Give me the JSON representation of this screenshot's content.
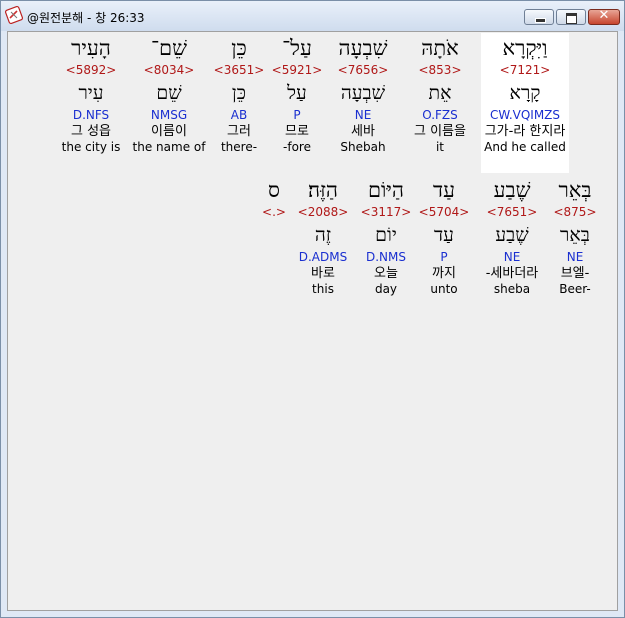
{
  "window": {
    "title": "@원전분해 - 창 26:33",
    "close_glyph": "✕"
  },
  "rows": [
    {
      "words": [
        {
          "heb": "וַיִּקְרָא",
          "num": "<7121>",
          "lex": "קָרָא",
          "morph": "CW.VQIMZS",
          "kor": "그가-라 한지라",
          "eng": "And he called",
          "highlight": true
        },
        {
          "heb": "אֹתָהּ",
          "num": "<853>",
          "lex": "אֵת",
          "morph": "O.FZS",
          "kor": "그 이름을",
          "eng": "it"
        },
        {
          "heb": "שִׁבְעָה",
          "num": "<7656>",
          "lex": "שִׁבְעָה",
          "morph": "NE",
          "kor": "세바",
          "eng": "Shebah"
        },
        {
          "heb": "עַל־",
          "num": "<5921>",
          "lex": "עַל",
          "morph": "P",
          "kor": "므로",
          "eng": "-fore"
        },
        {
          "heb": "כֵּן",
          "num": "<3651>",
          "lex": "כֵּן",
          "morph": "AB",
          "kor": "그러",
          "eng": "there-"
        },
        {
          "heb": "שֵׁם־",
          "num": "<8034>",
          "lex": "שֵׁם",
          "morph": "NMSG",
          "kor": "이름이",
          "eng": "the name of"
        },
        {
          "heb": "הָעִיר",
          "num": "<5892>",
          "lex": "עִיר",
          "morph": "D.NFS",
          "kor": "그 성읍",
          "eng": "the city is"
        }
      ]
    },
    {
      "words": [
        {
          "heb": "בְּאֵר",
          "num": "<875>",
          "lex": "בְּאֵר",
          "morph": "NE",
          "kor": "브엘-",
          "eng": "Beer-"
        },
        {
          "heb": "שֶׁבַע",
          "num": "<7651>",
          "lex": "שֶׁבַע",
          "morph": "NE",
          "kor": "-세바더라",
          "eng": "sheba"
        },
        {
          "heb": "עַד",
          "num": "<5704>",
          "lex": "עַד",
          "morph": "P",
          "kor": "까지",
          "eng": "unto"
        },
        {
          "heb": "הַיּוֹם",
          "num": "<3117>",
          "lex": "יוֹם",
          "morph": "D.NMS",
          "kor": "오늘",
          "eng": "day"
        },
        {
          "heb": "הַזֶּה׃",
          "num": "<2088>",
          "lex": "זֶה",
          "morph": "D.ADMS",
          "kor": "바로",
          "eng": "this"
        },
        {
          "heb": "ס",
          "num": "<.>",
          "lex": "",
          "morph": "",
          "kor": "",
          "eng": ""
        }
      ]
    }
  ]
}
